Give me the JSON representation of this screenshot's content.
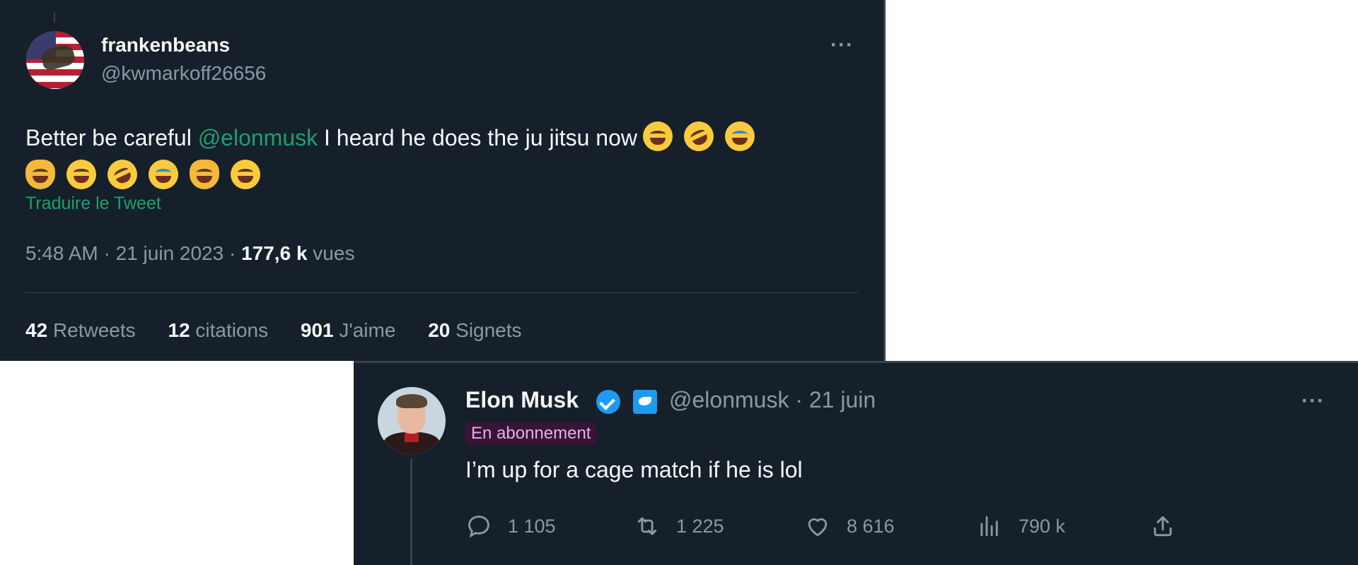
{
  "tweet1": {
    "display_name": "frankenbeans",
    "handle": "@kwmarkoff26656",
    "text_before": "Better be careful ",
    "mention": "@elonmusk",
    "text_after": " I heard he does the ju jitsu now",
    "emojis": [
      "grinning-squinting",
      "rofl",
      "joy",
      "joy-cat",
      "grinning-squinting",
      "rofl",
      "joy",
      "joy-cat",
      "grinning-squinting"
    ],
    "translate": "Traduire le Tweet",
    "time": "5:48 AM",
    "date": "21 juin 2023",
    "views_count": "177,6 k",
    "views_label": "vues",
    "stats": [
      {
        "count": "42",
        "label": "Retweets"
      },
      {
        "count": "12",
        "label": "citations"
      },
      {
        "count": "901",
        "label": "J'aime"
      },
      {
        "count": "20",
        "label": "Signets"
      }
    ]
  },
  "tweet2": {
    "display_name": "Elon Musk",
    "handle_date": "@elonmusk · 21 juin",
    "badge": "En abonnement",
    "text": "I’m up for a cage match if he is lol",
    "actions": {
      "reply": "1 105",
      "retweet": "1 225",
      "like": "8 616",
      "views": "790 k"
    }
  },
  "separators": {
    "dot": " · "
  },
  "colors": {
    "background": "#15202b",
    "accent_link": "#1f9f6e",
    "muted": "#8b98a5",
    "verified": "#1d9bf0"
  },
  "icons": [
    "more-icon",
    "verified-badge-icon",
    "affiliate-badge-icon",
    "reply-icon",
    "retweet-icon",
    "like-icon",
    "views-icon",
    "share-icon"
  ]
}
